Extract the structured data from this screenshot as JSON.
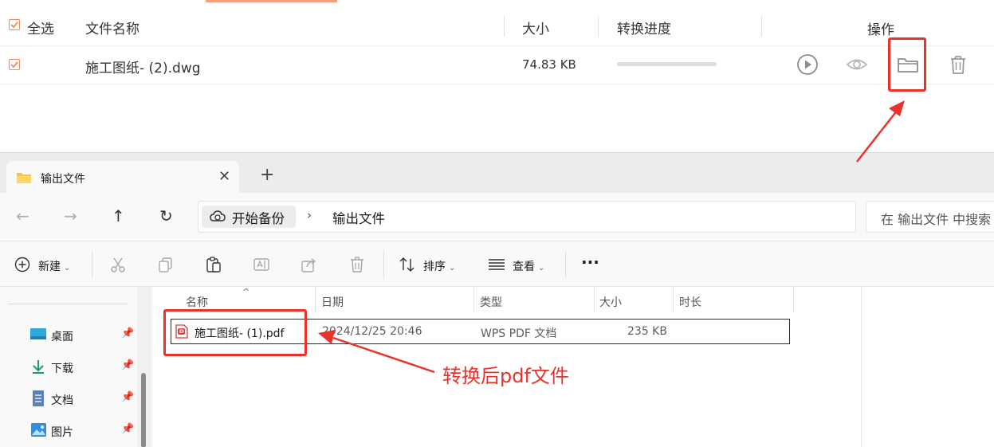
{
  "converter": {
    "select_all_label": "全选",
    "col_filename": "文件名称",
    "col_size": "大小",
    "col_progress": "转换进度",
    "col_actions": "操作",
    "file": {
      "name": "施工图纸- (2).dwg",
      "size": "74.83 KB",
      "progress": 0
    },
    "accent_color": "#f08a5d"
  },
  "explorer": {
    "tab_title": "输出文件",
    "breadcrumb": [
      "开始备份",
      "输出文件"
    ],
    "search_placeholder": "在 输出文件 中搜索",
    "toolbar": {
      "new_label": "新建",
      "sort_label": "排序",
      "view_label": "查看",
      "more_label": "···"
    },
    "sidebar": [
      {
        "label": "桌面",
        "icon": "desktop-icon"
      },
      {
        "label": "下载",
        "icon": "download-icon"
      },
      {
        "label": "文档",
        "icon": "document-icon"
      },
      {
        "label": "图片",
        "icon": "picture-icon"
      }
    ],
    "columns": [
      "名称",
      "日期",
      "类型",
      "大小",
      "时长"
    ],
    "files": [
      {
        "name": "施工图纸- (1).pdf",
        "date": "2024/12/25 20:46",
        "type": "WPS PDF 文档",
        "size": "235 KB",
        "duration": ""
      }
    ]
  },
  "annotation": {
    "text": "转换后pdf文件",
    "color": "#e8322a"
  }
}
